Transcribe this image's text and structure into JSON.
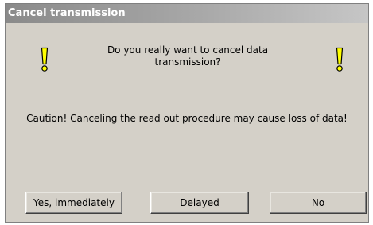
{
  "dialog": {
    "title": "Cancel transmission",
    "question": "Do you really want to cancel data transmission?",
    "caution": "Caution! Canceling the read out procedure may cause loss of data!",
    "icons": {
      "left": "warning-exclamation-icon",
      "right": "warning-exclamation-icon"
    },
    "buttons": {
      "yes_label": "Yes, immediately",
      "delayed_label": "Delayed",
      "no_label": "No"
    },
    "colors": {
      "face": "#d4d0c8",
      "title_bar": "#a9a9a9",
      "title_text": "#ffffff",
      "icon_fill": "#ffff00"
    }
  }
}
